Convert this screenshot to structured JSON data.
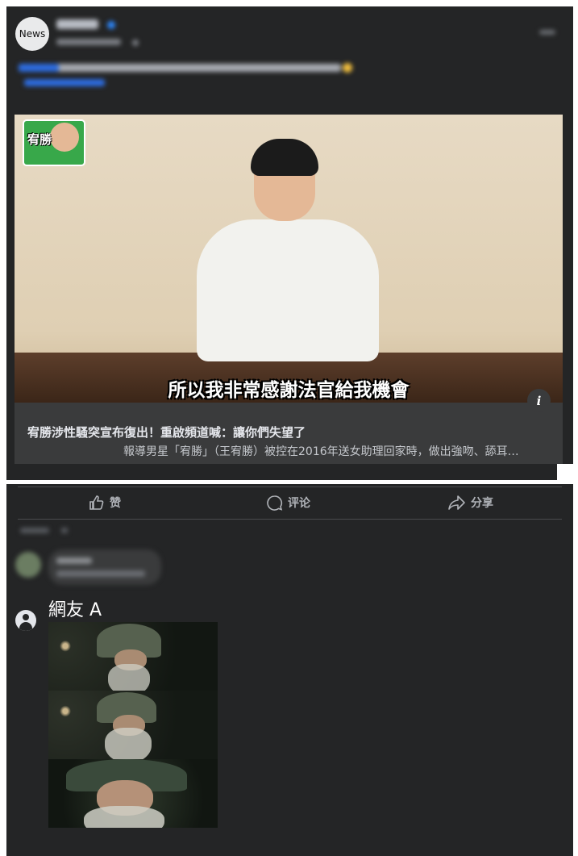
{
  "post": {
    "avatar_label": "News"
  },
  "link_card": {
    "video_subtitle": "所以我非常感謝法官給我機會",
    "sticker_text": "宥勝",
    "info_icon_glyph": "i",
    "title": "宥勝涉性騷突宣布復出！重啟頻道喊：讓你們失望了",
    "description": "報導男星「宥勝」（王宥勝）被控在2016年送女助理回家時，做出強吻、舔耳…"
  },
  "actions": {
    "like": {
      "label": "赞",
      "icon": "thumbs-up-icon"
    },
    "comment": {
      "label": "评论",
      "icon": "speech-bubble-icon"
    },
    "share": {
      "label": "分享",
      "icon": "share-arrow-icon"
    }
  },
  "reply": {
    "author": "網友 A",
    "avatar_icon": "user-circle-icon",
    "attachment": "gandalf-reaction-meme"
  },
  "colors": {
    "background": "#242526",
    "card": "#3a3b3c",
    "text": "#e4e6eb",
    "secondary_text": "#b0b3b8"
  }
}
